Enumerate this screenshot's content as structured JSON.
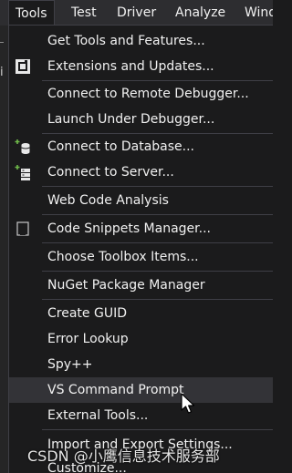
{
  "menubar": {
    "items": [
      {
        "label": "Tools"
      },
      {
        "label": "Test"
      },
      {
        "label": "Driver"
      },
      {
        "label": "Analyze"
      },
      {
        "label": "Windo"
      }
    ]
  },
  "edge": {
    "fragment_text": "i"
  },
  "menu": {
    "items": [
      {
        "label": "Get Tools and Features..."
      },
      {
        "label": "Extensions and Updates...",
        "icon": "extensions-icon"
      },
      {
        "label": "Connect to Remote Debugger..."
      },
      {
        "label": "Launch Under Debugger..."
      },
      {
        "label": "Connect to Database...",
        "icon": "database-connect-icon"
      },
      {
        "label": "Connect to Server...",
        "icon": "server-connect-icon"
      },
      {
        "label": "Web Code Analysis"
      },
      {
        "label": "Code Snippets Manager...",
        "icon": "snippets-icon"
      },
      {
        "label": "Choose Toolbox Items..."
      },
      {
        "label": "NuGet Package Manager"
      },
      {
        "label": "Create GUID"
      },
      {
        "label": "Error Lookup"
      },
      {
        "label": "Spy++"
      },
      {
        "label": "VS Command Prompt"
      },
      {
        "label": "External Tools..."
      },
      {
        "label": "Import and Export Settings..."
      },
      {
        "label": "Customize..."
      }
    ]
  },
  "watermark": {
    "text": "CSDN @小鹰信息技术服务部"
  },
  "colors": {
    "menu_bg": "#1b1b1c",
    "menubar_bg": "#2d2d30",
    "hover_bg": "#333337",
    "text": "#f1f1f1",
    "separator": "#3f3f46",
    "accent_green": "#6fba4a"
  }
}
